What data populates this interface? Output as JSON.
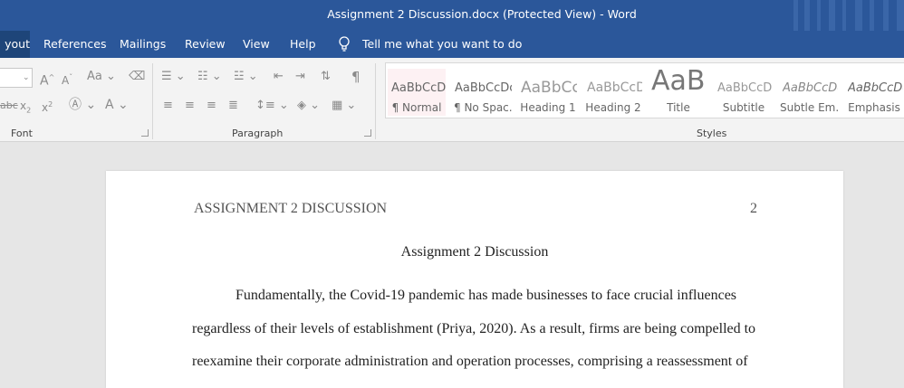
{
  "window": {
    "title": "Assignment 2 Discussion.docx (Protected View)  -  Word"
  },
  "tabs": [
    {
      "label": "yout"
    },
    {
      "label": "References"
    },
    {
      "label": "Mailings"
    },
    {
      "label": "Review"
    },
    {
      "label": "View"
    },
    {
      "label": "Help"
    }
  ],
  "tell_me": {
    "placeholder": "Tell me what you want to do"
  },
  "ribbon": {
    "font_group": {
      "label": "Font",
      "font_size_value": "",
      "case_label": "Aa"
    },
    "paragraph_group": {
      "label": "Paragraph"
    },
    "styles_group": {
      "label": "Styles",
      "styles": [
        {
          "preview": "AaBbCcDc",
          "name": "¶ Normal"
        },
        {
          "preview": "AaBbCcDc",
          "name": "¶ No Spac..."
        },
        {
          "preview": "AaBbCc",
          "name": "Heading 1"
        },
        {
          "preview": "AaBbCcD",
          "name": "Heading 2"
        },
        {
          "preview": "AaB",
          "name": "Title"
        },
        {
          "preview": "AaBbCcD",
          "name": "Subtitle"
        },
        {
          "preview": "AaBbCcDc",
          "name": "Subtle Em..."
        },
        {
          "preview": "AaBbCcDc",
          "name": "Emphasis"
        }
      ]
    }
  },
  "document": {
    "header_text": "ASSIGNMENT 2 DISCUSSION",
    "page_number": "2",
    "title": "Assignment 2 Discussion",
    "lines": [
      "Fundamentally, the Covid-19 pandemic has made businesses to face crucial influences",
      "regardless of their levels of establishment (Priya, 2020). As a result, firms are being compelled to",
      "reexamine their corporate administration and operation processes, comprising a reassessment of"
    ]
  }
}
